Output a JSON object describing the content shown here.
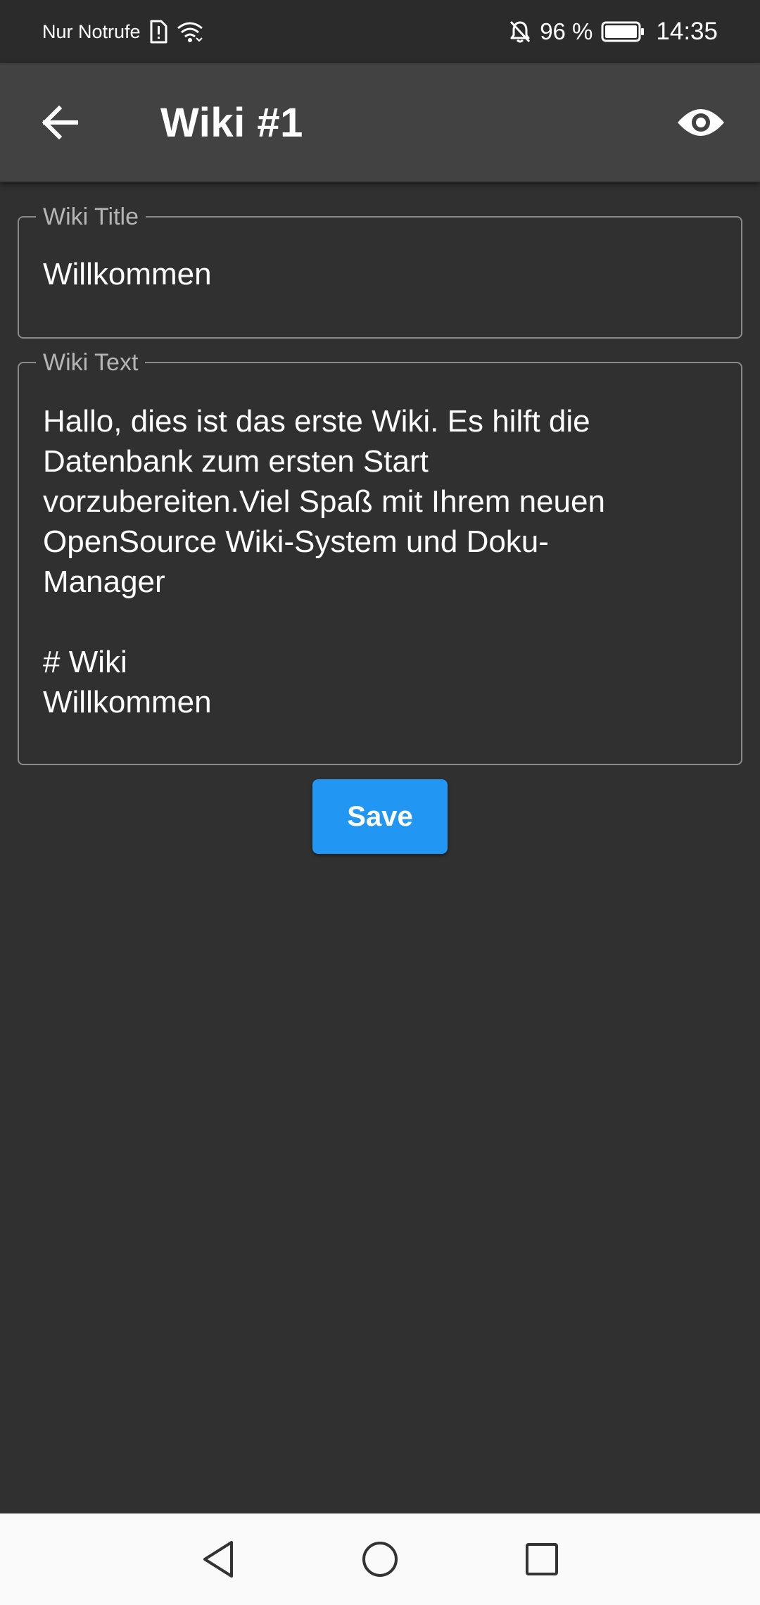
{
  "status_bar": {
    "carrier": "Nur Notrufe",
    "battery_percent": "96 %",
    "time": "14:35",
    "icons": [
      "sim-alert-icon",
      "wifi-icon",
      "bell-off-icon",
      "battery-icon"
    ]
  },
  "app_bar": {
    "title": "Wiki #1",
    "back_icon": "arrow-left-icon",
    "preview_icon": "eye-icon"
  },
  "form": {
    "title_label": "Wiki Title",
    "title_value": "Willkommen",
    "text_label": "Wiki Text",
    "text_value": "Hallo, dies ist das erste Wiki. Es hilft die\nDatenbank zum ersten Start\nvorzubereiten.Viel Spaß mit Ihrem neuen\nOpenSource Wiki-System und Doku-\nManager\n\n# Wiki\nWillkommen",
    "save_label": "Save"
  },
  "navigation_bar": {
    "buttons": [
      "back-triangle-icon",
      "home-circle-icon",
      "recents-square-icon"
    ]
  },
  "colors": {
    "background": "#303030",
    "app_bar": "#424242",
    "accent": "#2196f3",
    "field_border": "#8a8a8a"
  }
}
